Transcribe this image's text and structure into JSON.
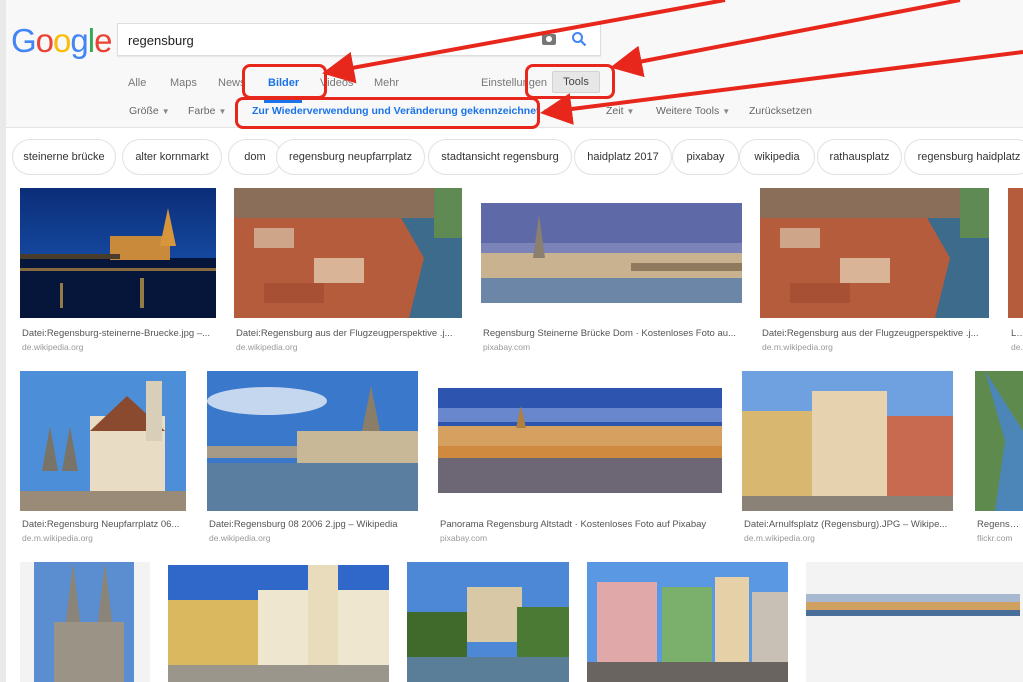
{
  "logo": {
    "letters": [
      "G",
      "o",
      "o",
      "g",
      "l",
      "e"
    ],
    "colors": [
      "#4285F4",
      "#EA4335",
      "#FBBC05",
      "#4285F4",
      "#34A853",
      "#EA4335"
    ]
  },
  "search": {
    "value": "regensburg"
  },
  "icons": {
    "camera": "camera-icon",
    "search": "search-icon"
  },
  "tabs": {
    "all": "Alle",
    "maps": "Maps",
    "news": "News",
    "images": "Bilder",
    "videos": "Videos",
    "more": "Mehr",
    "settings": "Einstellungen",
    "tools": "Tools"
  },
  "filters": {
    "size": "Größe",
    "color": "Farbe",
    "usage": "Zur Wiederverwendung und Veränderung gekennzeichnet",
    "time": "Zeit",
    "more_tools": "Weitere Tools",
    "reset": "Zurücksetzen"
  },
  "chips": [
    "steinerne brücke",
    "alter kornmarkt",
    "dom",
    "regensburg neupfarrplatz",
    "stadtansicht regensburg",
    "haidplatz 2017",
    "pixabay",
    "wikipedia",
    "rathausplatz",
    "regensburg haidplatz"
  ],
  "results": {
    "row1": [
      {
        "title": "Datei:Regensburg-steinerne-Bruecke.jpg –...",
        "source": "de.wikipedia.org"
      },
      {
        "title": "Datei:Regensburg aus der Flugzeugperspektive .j...",
        "source": "de.wikipedia.org"
      },
      {
        "title": "Regensburg Steinerne Brücke Dom · Kostenloses Foto au...",
        "source": "pixabay.com"
      },
      {
        "title": "Datei:Regensburg aus der Flugzeugperspektive .j...",
        "source": "de.m.wikipedia.org"
      },
      {
        "title": "Lis",
        "source": "de."
      }
    ],
    "row2": [
      {
        "title": "Datei:Regensburg Neupfarrplatz 06...",
        "source": "de.m.wikipedia.org"
      },
      {
        "title": "Datei:Regensburg 08 2006 2.jpg – Wikipedia",
        "source": "de.wikipedia.org"
      },
      {
        "title": "Panorama Regensburg Altstadt · Kostenloses Foto auf Pixabay",
        "source": "pixabay.com"
      },
      {
        "title": "Datei:Arnulfsplatz (Regensburg).JPG – Wikipe...",
        "source": "de.m.wikipedia.org"
      },
      {
        "title": "Regensburg",
        "source": "flickr.com"
      }
    ]
  },
  "colors": {
    "accent": "#1a73e8",
    "annotation": "#e8271c"
  }
}
